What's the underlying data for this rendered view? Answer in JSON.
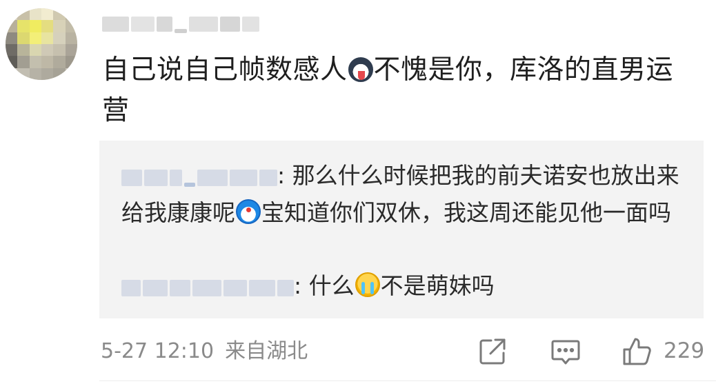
{
  "comment": {
    "text_part1": "自己说自己帧数感人",
    "emoji1": "husky-emoji",
    "text_part2": "不愧是你，库洛的直男运营"
  },
  "replies": [
    {
      "text_part1": "那么什么时候把我的前夫诺安也放出来给我康康呢",
      "emoji": "doraemon-emoji",
      "text_part2": "宝知道你们双休，我这周还能见他一面吗"
    },
    {
      "text_part1": "什么",
      "emoji": "crying-emoji",
      "text_part2": "不是萌妹吗"
    }
  ],
  "footer": {
    "time": "5-27 12:10",
    "location": "来自湖北",
    "like_count": "229",
    "share_icon": "share-icon",
    "comment_icon": "comment-icon",
    "like_icon": "thumbs-up-icon"
  },
  "colors": {
    "reply_bg": "#f3f3f3",
    "meta_text": "#8a8a8a",
    "body_text": "#1f1f1f"
  }
}
